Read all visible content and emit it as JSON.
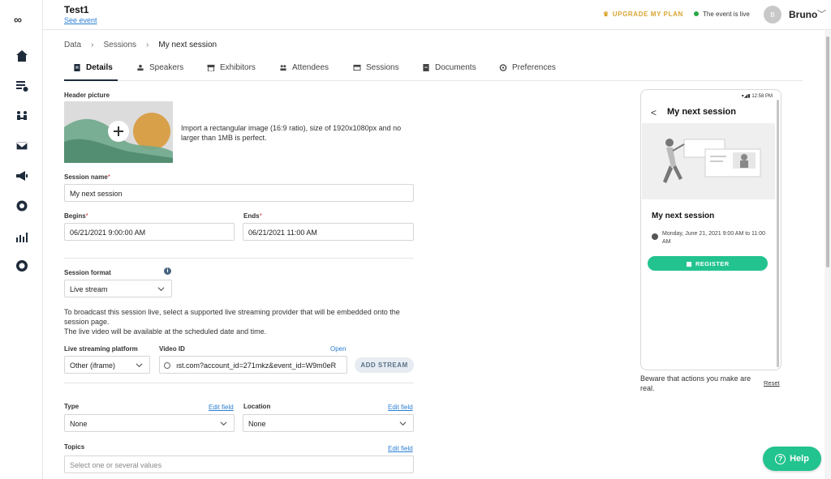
{
  "colors": {
    "accent": "#22c38e",
    "upgrade": "#d9a431",
    "link": "#2a7fd4",
    "nav": "#1e2b3b",
    "live": "#27a745"
  },
  "sidebar": {
    "logo": "∞",
    "items": [
      {
        "name": "home-icon"
      },
      {
        "name": "registrations-icon"
      },
      {
        "name": "people-icon"
      },
      {
        "name": "mail-icon"
      },
      {
        "name": "megaphone-icon"
      },
      {
        "name": "settings-icon"
      },
      {
        "name": "analytics-icon"
      },
      {
        "name": "support-icon"
      }
    ]
  },
  "header": {
    "event_title": "Test1",
    "see_event": "See event",
    "upgrade": "UPGRADE MY PLAN",
    "live_status": "The event is live",
    "avatar_initial": "B",
    "username": "Bruno"
  },
  "breadcrumb": {
    "items": [
      "Data",
      "Sessions",
      "My next session"
    ]
  },
  "tabs": [
    {
      "label": "Details",
      "icon": "document-icon"
    },
    {
      "label": "Speakers",
      "icon": "speaker-icon"
    },
    {
      "label": "Exhibitors",
      "icon": "store-icon"
    },
    {
      "label": "Attendees",
      "icon": "people-icon"
    },
    {
      "label": "Sessions",
      "icon": "calendar-icon"
    },
    {
      "label": "Documents",
      "icon": "file-icon"
    },
    {
      "label": "Preferences",
      "icon": "gear-icon"
    }
  ],
  "form": {
    "header_picture_label": "Header picture",
    "import_text": "Import a rectangular image (16:9 ratio), size of 1920x1080px and no larger than 1MB is perfect.",
    "session_name_label": "Session name",
    "session_name_value": "My next session",
    "begins_label": "Begins",
    "begins_value": "06/21/2021 9:00:00 AM",
    "ends_label": "Ends",
    "ends_value": "06/21/2021 11:00 AM",
    "required_mark": "*",
    "session_format_label": "Session format",
    "session_format_value": "Live stream",
    "info_mark": "i",
    "broadcast_text_1": "To broadcast this session live, select a supported live streaming provider that will be embedded onto the session page.",
    "broadcast_text_2": "The live video will be available at the scheduled date and time.",
    "platform_label": "Live streaming platform",
    "platform_value": "Other (iframe)",
    "video_id_label": "Video ID",
    "open_link": "Open",
    "video_id_value": "ıst.com?account_id=271mkz&event_id=W9m0eR",
    "add_stream": "ADD STREAM",
    "type_label": "Type",
    "type_edit": "Edit field",
    "type_value": "None",
    "location_label": "Location",
    "location_edit": "Edit field",
    "location_value": "None",
    "topics_label": "Topics",
    "topics_edit": "Edit field",
    "topics_placeholder": "Select one or several values"
  },
  "preview": {
    "status_time": "12:58 PM",
    "back": "<",
    "title": "My next session",
    "session_name": "My next session",
    "datetime": "Monday, June 21, 2021 9:00 AM to 11:00 AM",
    "register": "REGISTER",
    "beware": "Beware that actions you make are real.",
    "reset": "Reset"
  },
  "help": {
    "label": "Help",
    "icon": "?"
  }
}
